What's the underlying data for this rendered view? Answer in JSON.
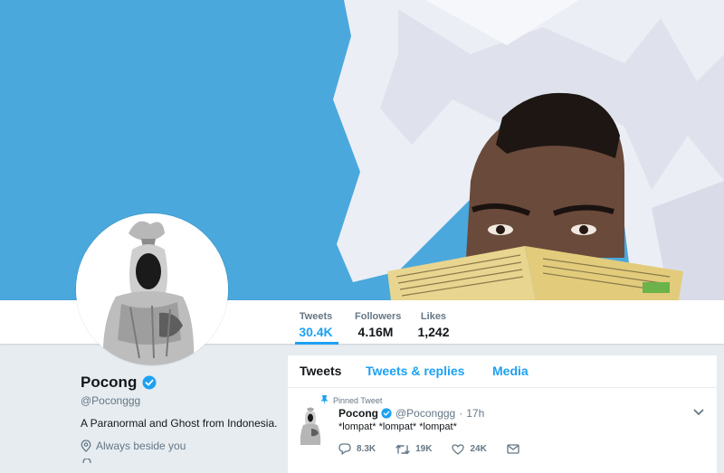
{
  "profile": {
    "name": "Pocong",
    "handle": "@Poconggg",
    "bio": "A Paranormal and Ghost from Indonesia.",
    "location": "Always beside you",
    "verified": true
  },
  "stats": [
    {
      "label": "Tweets",
      "value": "30.4K",
      "active": true
    },
    {
      "label": "Followers",
      "value": "4.16M",
      "active": false
    },
    {
      "label": "Likes",
      "value": "1,242",
      "active": false
    }
  ],
  "timeline_tabs": [
    {
      "label": "Tweets",
      "active": true
    },
    {
      "label": "Tweets & replies",
      "active": false
    },
    {
      "label": "Media",
      "active": false
    }
  ],
  "tweet": {
    "pinned_label": "Pinned Tweet",
    "author": "Pocong",
    "handle": "@Poconggg",
    "time": "17h",
    "text": "*lompat* *lompat* *lompat*",
    "replies": "8.3K",
    "retweets": "19K",
    "likes": "24K"
  },
  "colors": {
    "accent": "#1da1f2",
    "banner_sky": "#4aa8dc",
    "page_bg": "#e6ecf0"
  },
  "icons": [
    "verified-badge-icon",
    "location-pin-icon",
    "pin-icon",
    "chevron-down-icon",
    "reply-icon",
    "retweet-icon",
    "heart-icon",
    "message-icon"
  ]
}
